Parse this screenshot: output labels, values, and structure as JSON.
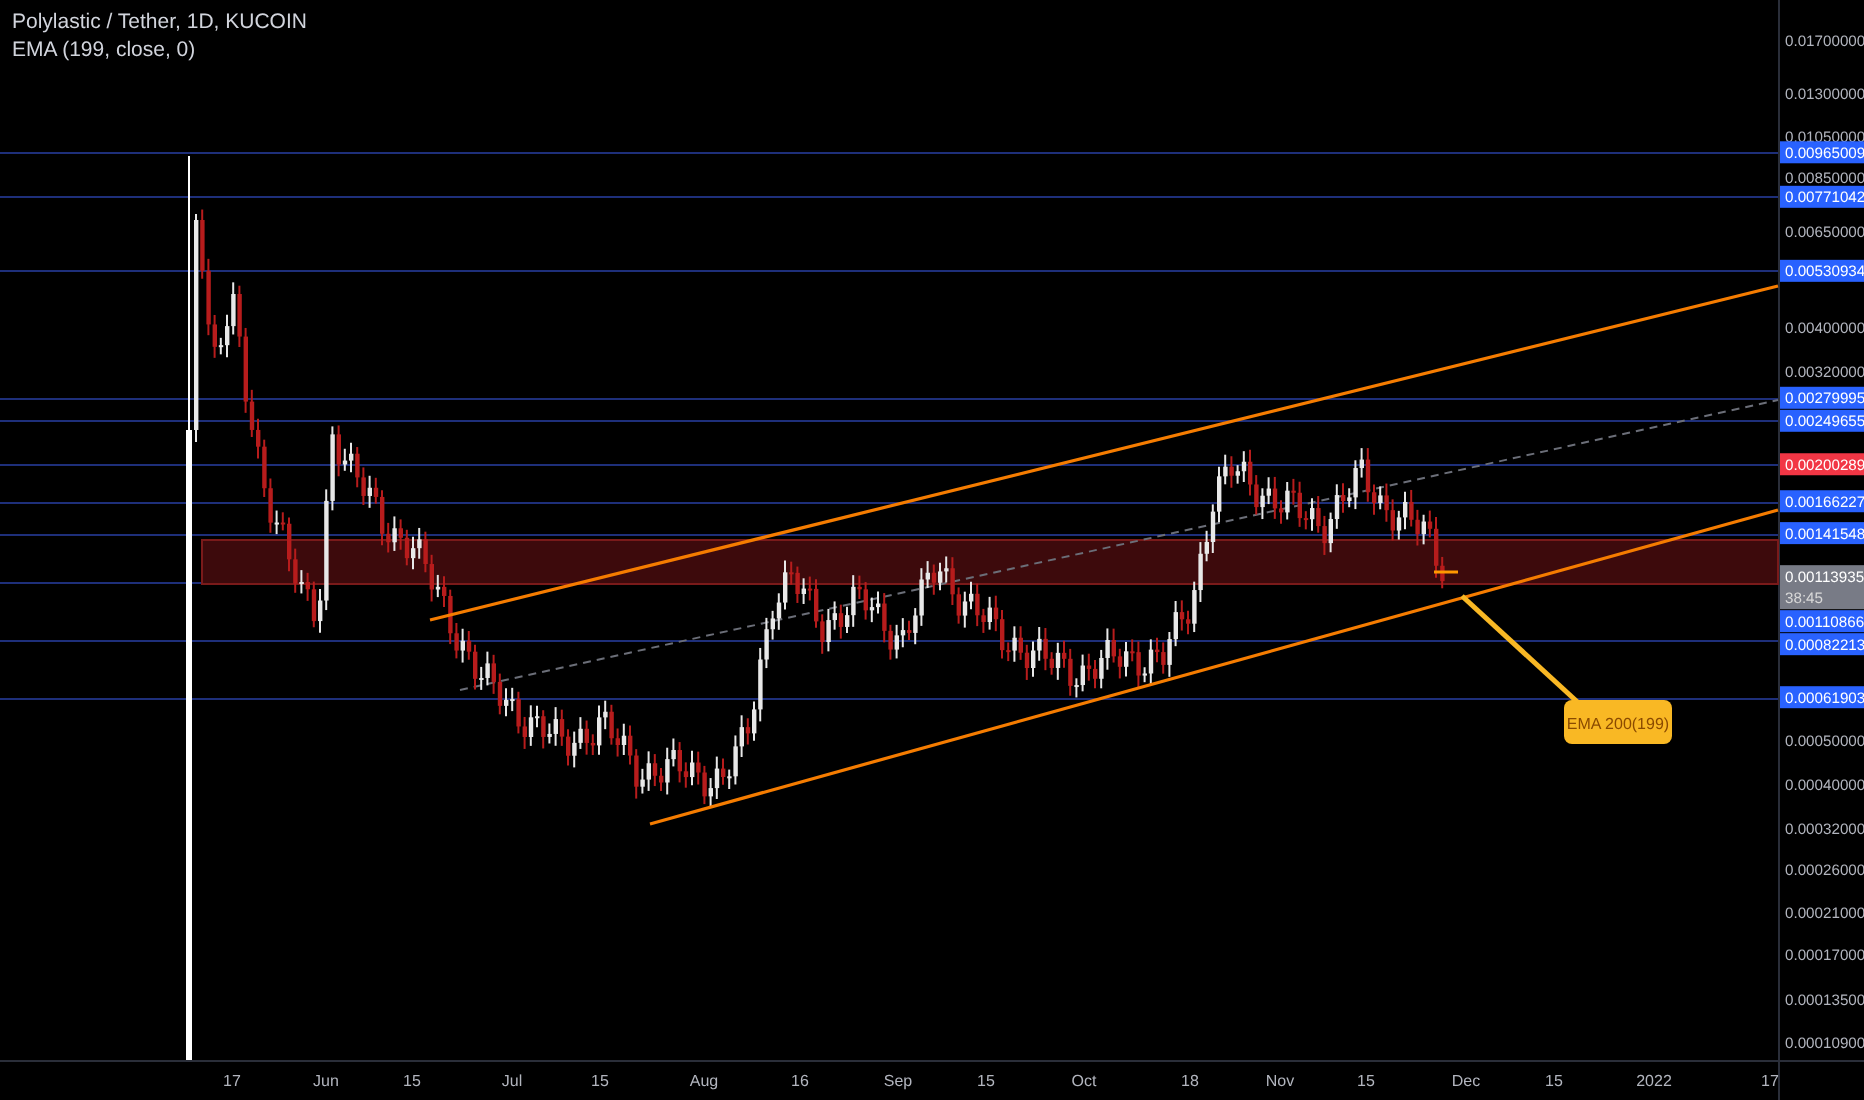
{
  "legend": {
    "title": "Polylastic / Tether, 1D, KUCOIN",
    "indicator": "EMA (199, close, 0)"
  },
  "price_axis": {
    "ticks": [
      "0.01700000",
      "0.01300000",
      "0.01050000",
      "0.00850000",
      "0.00650000",
      "0.00400000",
      "0.00320000",
      "0.00050000",
      "0.00040000",
      "0.00032000",
      "0.00026000",
      "0.00021000",
      "0.00017000",
      "0.00013500",
      "0.00010900"
    ]
  },
  "price_tags": [
    {
      "value": "0.00965009",
      "color": "#2962ff"
    },
    {
      "value": "0.00771042",
      "color": "#2962ff"
    },
    {
      "value": "0.00530934",
      "color": "#2962ff"
    },
    {
      "value": "0.00279995",
      "color": "#2962ff"
    },
    {
      "value": "0.00249655",
      "color": "#2962ff"
    },
    {
      "value": "0.00200289",
      "color": "#f23645"
    },
    {
      "value": "0.00166227",
      "color": "#2962ff"
    },
    {
      "value": "0.00141548",
      "color": "#2962ff"
    },
    {
      "value": "0.00113935",
      "color": "#787b86",
      "countdown": "38:45"
    },
    {
      "value": "0.00110866",
      "color": "#2962ff"
    },
    {
      "value": "0.00082213",
      "color": "#2962ff"
    },
    {
      "value": "0.00061903",
      "color": "#2962ff"
    }
  ],
  "time_axis": {
    "labels": [
      "17",
      "Jun",
      "15",
      "Jul",
      "15",
      "Aug",
      "16",
      "Sep",
      "15",
      "Oct",
      "18",
      "Nov",
      "15",
      "Dec",
      "15",
      "2022",
      "17"
    ]
  },
  "annotation": {
    "text": "EMA 200(199)"
  }
}
